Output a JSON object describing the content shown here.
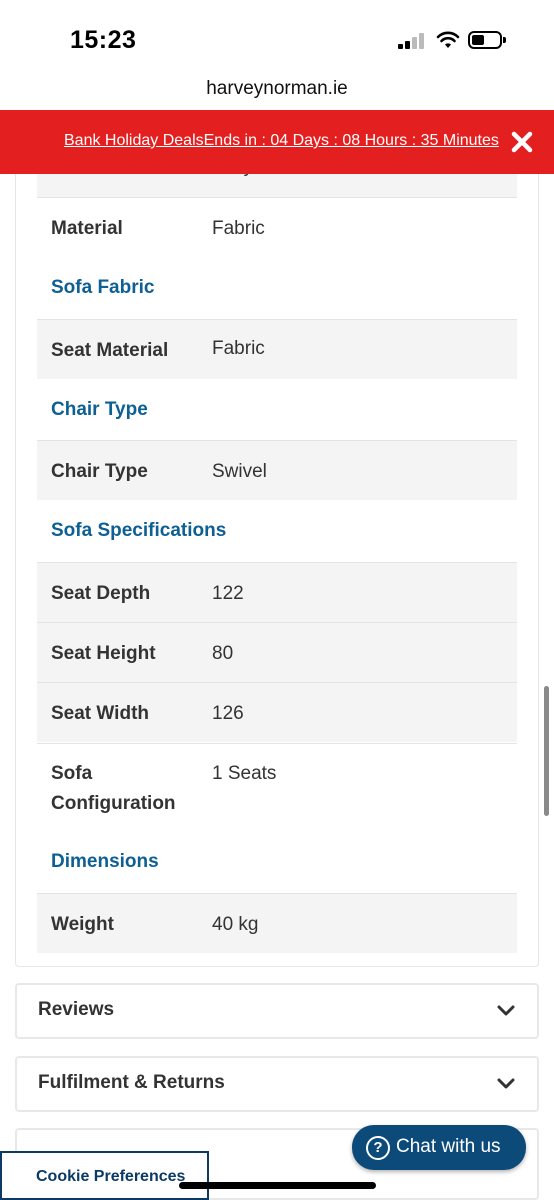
{
  "status_bar": {
    "time": "15:23"
  },
  "browser": {
    "url": "harveynorman.ie"
  },
  "promo": {
    "text": "Bank Holiday DealsEnds in : 04 Days : 08 Hours : 35 Minutes"
  },
  "specs": {
    "rows": [
      {
        "label": "Material",
        "value": "Fabric"
      },
      {
        "label": "Seat Material",
        "value": "Fabric"
      },
      {
        "label": "Chair Type",
        "value": "Swivel"
      },
      {
        "label": "Seat Depth",
        "value": "122"
      },
      {
        "label": "Seat Height",
        "value": "80"
      },
      {
        "label": "Seat Width",
        "value": "126"
      },
      {
        "label_line1": "Sofa",
        "label_line2": "Configuration",
        "value": "1 Seats"
      },
      {
        "label": "Weight",
        "value": "40 kg"
      }
    ],
    "sections": [
      "Sofa Fabric",
      "Chair Type",
      "Sofa Specifications",
      "Dimensions"
    ]
  },
  "accordions": [
    {
      "title": "Reviews"
    },
    {
      "title": "Fulfilment & Returns"
    }
  ],
  "chat": {
    "label": "Chat with us"
  },
  "cookie": {
    "label": "Cookie Preferences"
  },
  "colors": {
    "promo_bg": "#e3201f",
    "section_heading": "#0d5f94",
    "chat_bg": "#0c4a7a"
  }
}
